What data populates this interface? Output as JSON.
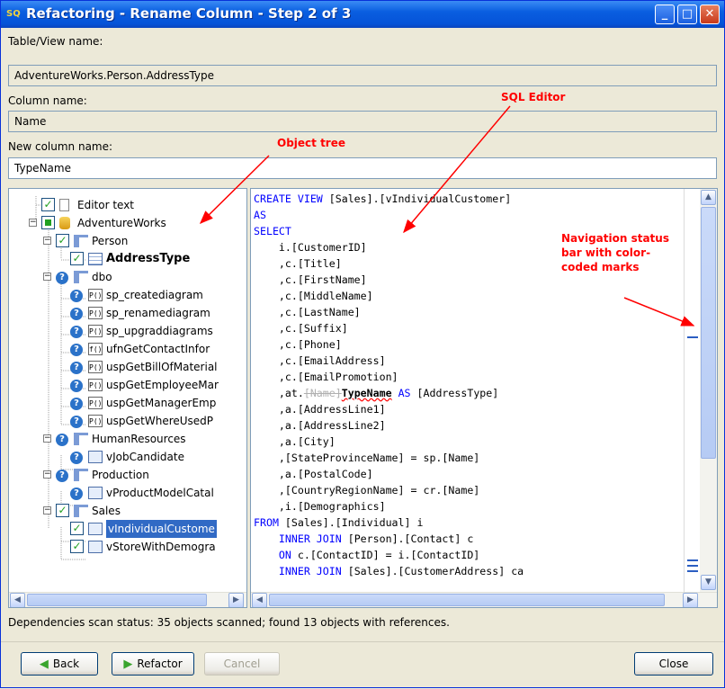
{
  "window": {
    "title": "Refactoring - Rename Column - Step 2 of 3",
    "app_icon": "SQ",
    "minimize": "_",
    "maximize": "□",
    "close": "✕"
  },
  "form": {
    "table_label": "Table/View name:",
    "table_value": "AdventureWorks.Person.AddressType",
    "column_label": "Column name:",
    "column_value": "Name",
    "new_column_label": "New column name:",
    "new_column_value": "TypeName"
  },
  "tree": {
    "items": [
      {
        "label": "Editor text",
        "icon": "document-icon",
        "check": "checked"
      },
      {
        "label": "AdventureWorks",
        "icon": "database-icon",
        "check": "partial"
      },
      {
        "label": "Person",
        "icon": "schema-icon",
        "check": "checked"
      },
      {
        "label": "AddressType",
        "icon": "table-icon",
        "check": "checked"
      },
      {
        "label": "dbo",
        "icon": "schema-icon",
        "check": "unknown"
      },
      {
        "label": "sp_creatediagram",
        "icon": "procedure-icon",
        "check": "unknown"
      },
      {
        "label": "sp_renamediagram",
        "icon": "procedure-icon",
        "check": "unknown"
      },
      {
        "label": "sp_upgraddiagrams",
        "icon": "procedure-icon",
        "check": "unknown"
      },
      {
        "label": "ufnGetContactInfor",
        "icon": "function-icon",
        "check": "unknown"
      },
      {
        "label": "uspGetBillOfMaterial",
        "icon": "procedure-icon",
        "check": "unknown"
      },
      {
        "label": "uspGetEmployeeMar",
        "icon": "procedure-icon",
        "check": "unknown"
      },
      {
        "label": "uspGetManagerEmp",
        "icon": "procedure-icon",
        "check": "unknown"
      },
      {
        "label": "uspGetWhereUsedP",
        "icon": "procedure-icon",
        "check": "unknown"
      },
      {
        "label": "HumanResources",
        "icon": "schema-icon",
        "check": "unknown"
      },
      {
        "label": "vJobCandidate",
        "icon": "view-icon",
        "check": "unknown"
      },
      {
        "label": "Production",
        "icon": "schema-icon",
        "check": "unknown"
      },
      {
        "label": "vProductModelCatal",
        "icon": "view-icon",
        "check": "unknown"
      },
      {
        "label": "Sales",
        "icon": "schema-icon",
        "check": "checked"
      },
      {
        "label": "vIndividualCustome",
        "icon": "view-icon",
        "check": "checked",
        "selected": true
      },
      {
        "label": "vStoreWithDemogra",
        "icon": "view-icon",
        "check": "checked"
      }
    ]
  },
  "editor": {
    "lines": [
      "CREATE VIEW [Sales].[vIndividualCustomer]",
      "AS",
      "SELECT",
      "    i.[CustomerID]",
      "    ,c.[Title]",
      "    ,c.[FirstName]",
      "    ,c.[MiddleName]",
      "    ,c.[LastName]",
      "    ,c.[Suffix]",
      "    ,c.[Phone]",
      "    ,c.[EmailAddress]",
      "    ,c.[EmailPromotion]",
      "    ,at.[Name]TypeName AS [AddressType]",
      "    ,a.[AddressLine1]",
      "    ,a.[AddressLine2]",
      "    ,a.[City]",
      "    ,[StateProvinceName] = sp.[Name]",
      "    ,a.[PostalCode]",
      "    ,[CountryRegionName] = cr.[Name]",
      "    ,i.[Demographics]",
      "FROM [Sales].[Individual] i",
      "    INNER JOIN [Person].[Contact] c",
      "    ON c.[ContactID] = i.[ContactID]",
      "    INNER JOIN [Sales].[CustomerAddress] ca"
    ],
    "rename_old": "[Name]",
    "rename_new": "TypeName"
  },
  "status": "Dependencies scan status: 35 objects scanned; found 13 objects with references.",
  "buttons": {
    "back": "Back",
    "refactor": "Refactor",
    "cancel": "Cancel",
    "close": "Close"
  },
  "annotations": {
    "object_tree": "Object tree",
    "sql_editor": "SQL Editor",
    "navigation": "Navigation status bar with color-coded marks"
  },
  "colors": {
    "annotation": "#ff0000",
    "keyword": "#0000ff",
    "selection": "#316ac5",
    "check": "#21a121"
  }
}
